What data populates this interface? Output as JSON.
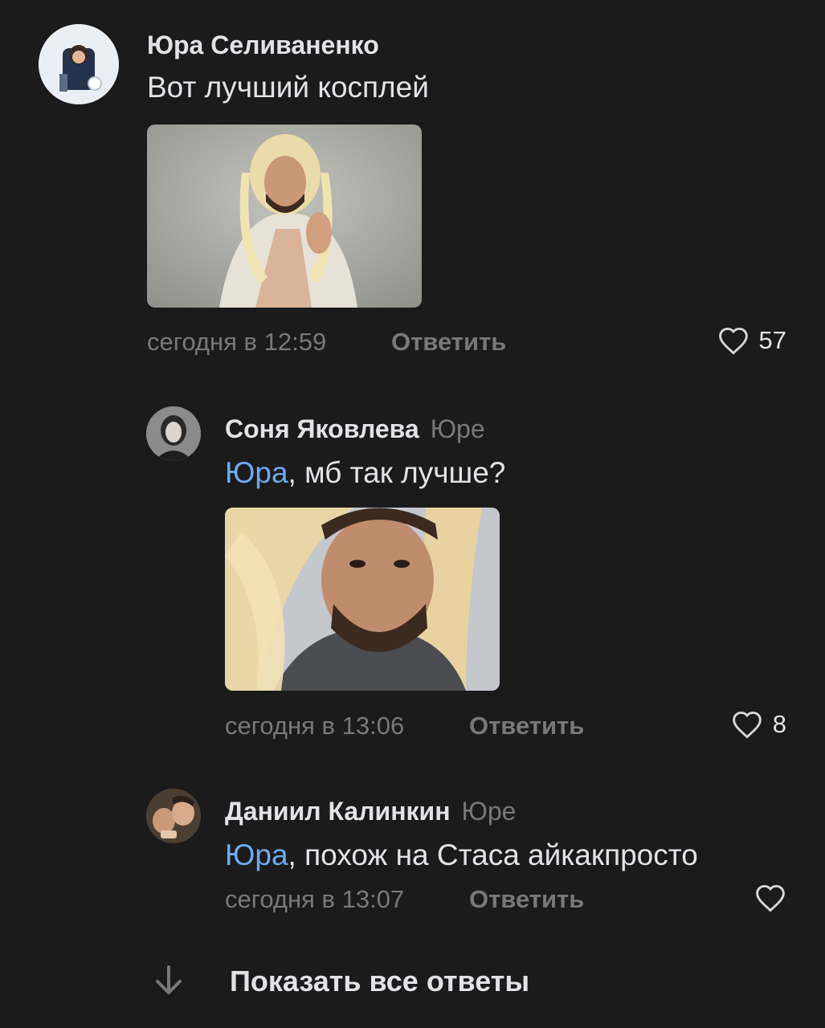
{
  "comment1": {
    "author": "Юра Селиваненко",
    "text": "Вот лучший косплей",
    "time": "сегодня в 12:59",
    "reply_label": "Ответить",
    "likes": "57"
  },
  "reply1": {
    "author": "Соня Яковлева",
    "reply_to": "Юре",
    "mention": "Юра",
    "text": ", мб так лучше?",
    "time": "сегодня в 13:06",
    "reply_label": "Ответить",
    "likes": "8"
  },
  "reply2": {
    "author": "Даниил Калинкин",
    "reply_to": "Юре",
    "mention": "Юра",
    "text": ", похож на Стаса айкакпросто",
    "time": "сегодня в 13:07",
    "reply_label": "Ответить"
  },
  "footer": {
    "show_all_label": "Показать все ответы"
  },
  "colors": {
    "background": "#1b1b1c",
    "mention": "#71aaeb",
    "secondary": "#76787a"
  },
  "icons": [
    "avatar",
    "heart-icon",
    "arrow-down-icon"
  ]
}
